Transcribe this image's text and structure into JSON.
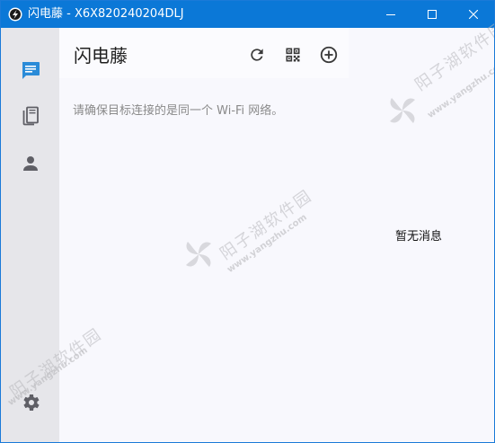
{
  "window": {
    "title": "闪电藤 - X6X820240204DLJ"
  },
  "sidebar": {
    "items": [
      {
        "name": "chat",
        "icon": "chat-icon",
        "active": true
      },
      {
        "name": "files",
        "icon": "devices-icon",
        "active": false
      },
      {
        "name": "person",
        "icon": "person-icon",
        "active": false
      },
      {
        "name": "settings",
        "icon": "gear-icon",
        "active": false
      }
    ]
  },
  "header": {
    "title": "闪电藤",
    "actions": [
      "refresh-icon",
      "qr-code-icon",
      "add-circle-icon"
    ]
  },
  "main": {
    "hint": "请确保目标连接的是同一个 Wi-Fi 网络。",
    "empty_text": "暂无消息"
  },
  "watermark": {
    "cn": "阳子湖软件园",
    "en": "www.yangzhu.com"
  },
  "colors": {
    "titlebar": "#0b78d7",
    "accent": "#2a8bd8",
    "sidebar": "#e6e6ea",
    "background": "#f8f8fd"
  }
}
